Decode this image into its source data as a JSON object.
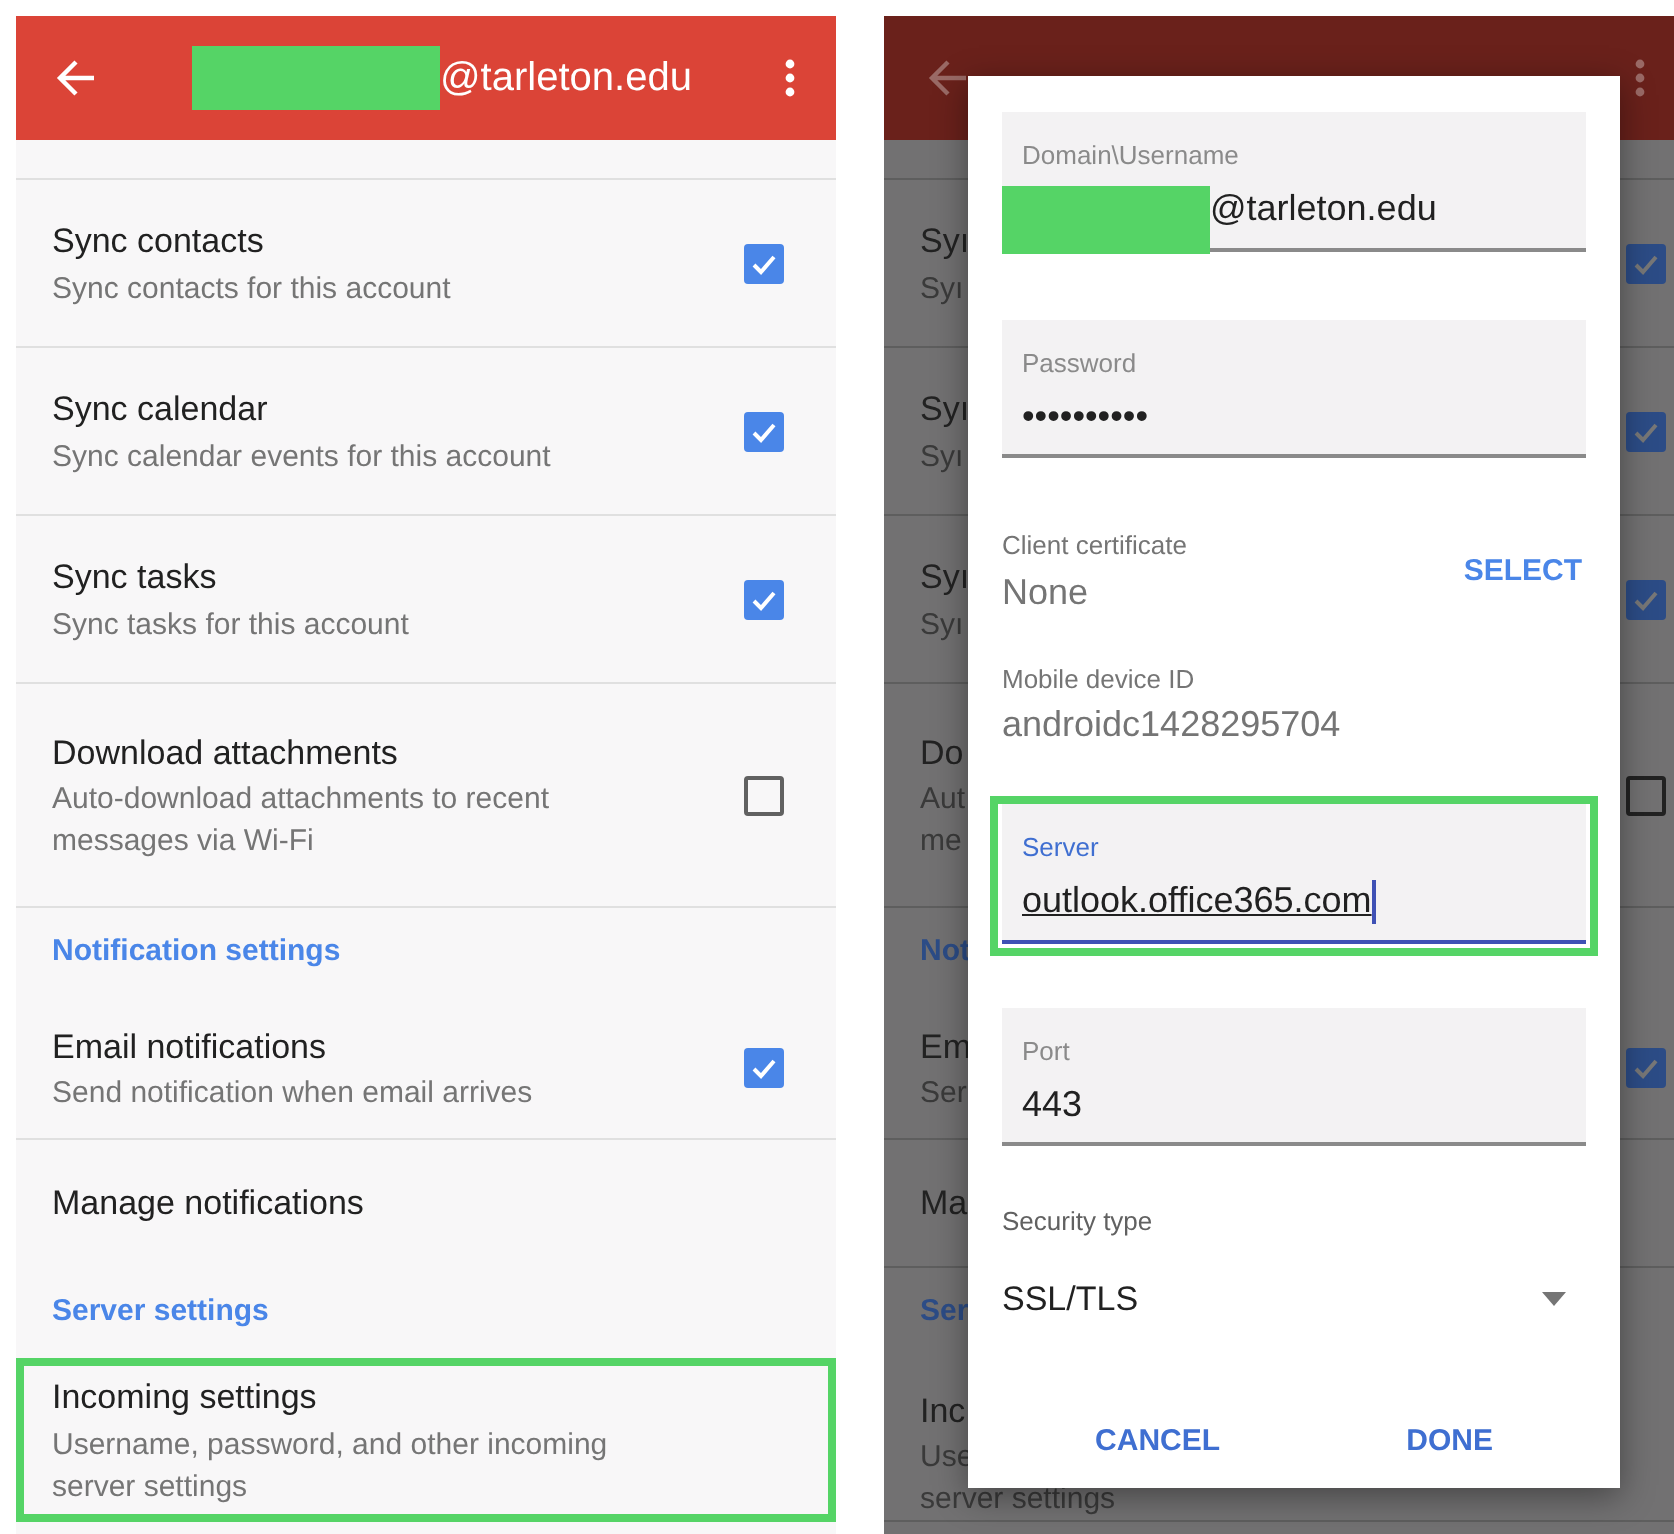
{
  "left": {
    "header": {
      "title": "@tarleton.edu",
      "redacted": true
    },
    "rows": [
      {
        "kind": "toggle",
        "title": "Sync contacts",
        "subtitle": "Sync contacts for this account",
        "checked": true
      },
      {
        "kind": "toggle",
        "title": "Sync calendar",
        "subtitle": "Sync calendar events for this account",
        "checked": true
      },
      {
        "kind": "toggle",
        "title": "Sync tasks",
        "subtitle": "Sync tasks for this account",
        "checked": true
      },
      {
        "kind": "toggle",
        "title": "Download attachments",
        "subtitle": "Auto-download attachments to recent messages via Wi-Fi",
        "checked": false
      },
      {
        "kind": "section",
        "title": "Notification settings"
      },
      {
        "kind": "toggle",
        "title": "Email notifications",
        "subtitle": "Send notification when email arrives",
        "checked": true
      },
      {
        "kind": "plain",
        "title": "Manage notifications"
      },
      {
        "kind": "section",
        "title": "Server settings"
      },
      {
        "kind": "plain",
        "title": "Incoming settings",
        "subtitle": "Username, password, and other incoming server settings",
        "highlighted": true
      }
    ]
  },
  "right": {
    "background_rows": [
      {
        "kind": "toggle",
        "title": "Syı",
        "subtitle_lines": [
          "Syı"
        ],
        "checked": true
      },
      {
        "kind": "toggle",
        "title": "Syı",
        "subtitle_lines": [
          "Syı"
        ],
        "checked": true
      },
      {
        "kind": "toggle",
        "title": "Syı",
        "subtitle_lines": [
          "Syı"
        ],
        "checked": true
      },
      {
        "kind": "toggle",
        "title": "Do",
        "subtitle_lines": [
          "Aut",
          "me"
        ],
        "checked": false
      },
      {
        "kind": "section",
        "title": "Not"
      },
      {
        "kind": "toggle",
        "title": "Em",
        "subtitle_lines": [
          "Ser"
        ],
        "checked": true
      },
      {
        "kind": "plain",
        "title": "Ma"
      },
      {
        "kind": "section",
        "title": "Ser"
      },
      {
        "kind": "plain",
        "title": "Inc",
        "subtitle_lines": [
          "Use",
          "server settings"
        ]
      }
    ],
    "dialog": {
      "fields": [
        {
          "kind": "text",
          "label": "Domain\\Username",
          "value": "@tarleton.edu",
          "redacted": true,
          "highlighted": false
        },
        {
          "kind": "text",
          "label": "Password",
          "value": "••••••••••",
          "highlighted": false
        },
        {
          "kind": "info",
          "label": "Client certificate",
          "value": "None",
          "action": "SELECT"
        },
        {
          "kind": "info",
          "label": "Mobile device ID",
          "value": "androidc1428295704"
        },
        {
          "kind": "text",
          "label": "Server",
          "value": "outlook.office365.com",
          "focused": true,
          "highlighted": true
        },
        {
          "kind": "text",
          "label": "Port",
          "value": "443",
          "highlighted": false
        },
        {
          "kind": "select",
          "label": "Security type",
          "value": "SSL/TLS"
        }
      ],
      "buttons": [
        "CANCEL",
        "DONE"
      ]
    }
  }
}
